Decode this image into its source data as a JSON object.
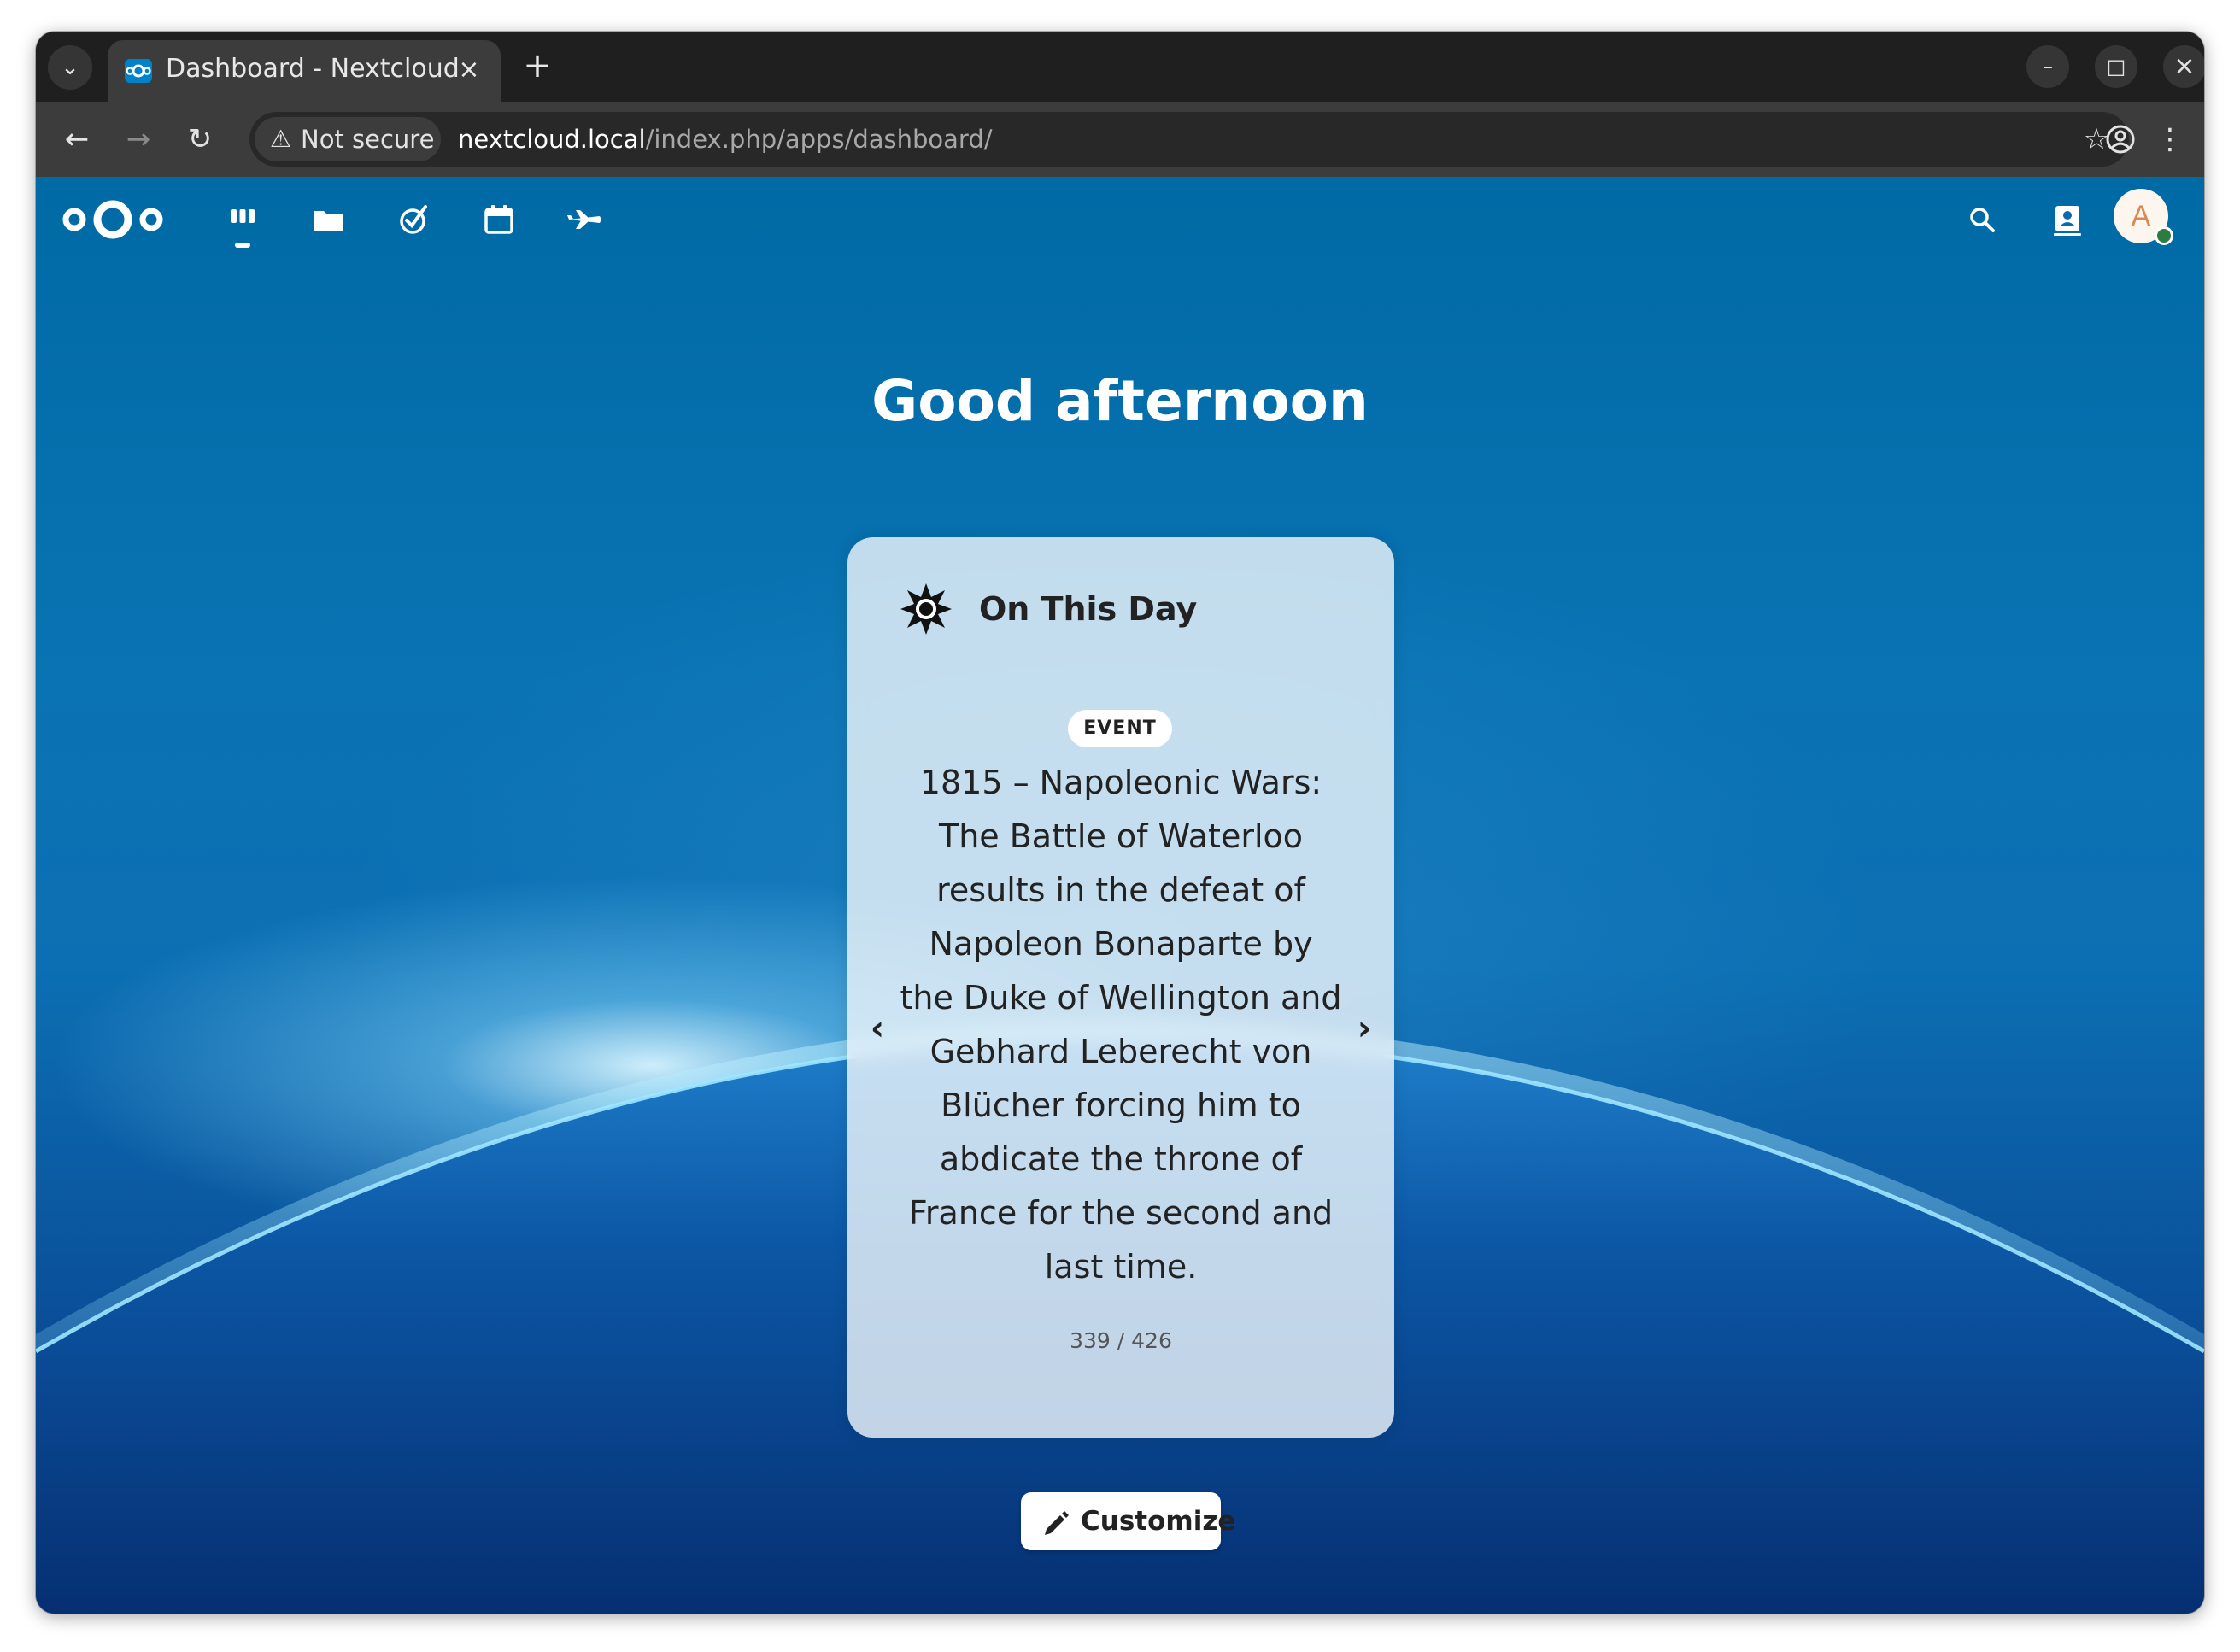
{
  "browser": {
    "tab_title": "Dashboard - Nextcloud",
    "tab_close": "×",
    "new_tab": "+",
    "security_label": "Not secure",
    "url_host": "nextcloud.local",
    "url_path": "/index.php/apps/dashboard/"
  },
  "nextcloud": {
    "apps": [
      "Dashboard",
      "Files",
      "Activity",
      "Calendar",
      "Announcements"
    ],
    "active_app": "Dashboard",
    "avatar_initial": "A",
    "accent_color": "#0082c9"
  },
  "greeting": "Good afternoon",
  "widget": {
    "title": "On This Day",
    "badge": "EVENT",
    "text": "1815 – Napoleonic Wars: The Battle of Waterloo results in the defeat of Napoleon Bonaparte by the Duke of Wellington and Gebhard Leberecht von Blücher forcing him to abdicate the throne of France for the second and last time.",
    "counter": "339 / 426",
    "prev_label": "‹",
    "next_label": "›"
  },
  "customize_label": "Customize"
}
